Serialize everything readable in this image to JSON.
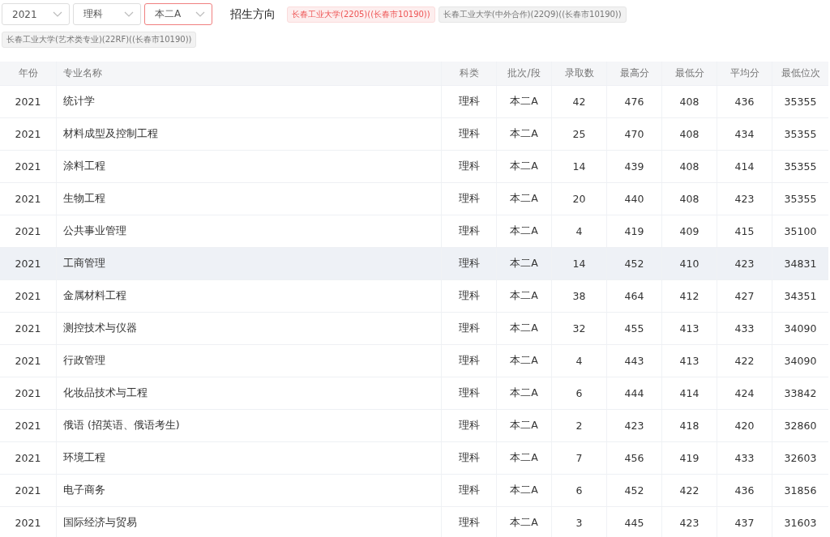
{
  "filters": [
    {
      "value": "2021",
      "active": false
    },
    {
      "value": "理科",
      "active": false
    },
    {
      "value": "本二A",
      "active": true
    }
  ],
  "direction_label": "招生方向",
  "direction_tags": [
    {
      "label": "长春工业大学(2205)((长春市10190))",
      "selected": true
    },
    {
      "label": "长春工业大学(中外合作)(22Q9)((长春市10190))",
      "selected": false
    },
    {
      "label": "长春工业大学(艺术类专业)(22RF)((长春市10190))",
      "selected": false
    }
  ],
  "table": {
    "columns": [
      "年份",
      "专业名称",
      "科类",
      "批次/段",
      "录取数",
      "最高分",
      "最低分",
      "平均分",
      "最低位次"
    ],
    "rows": [
      {
        "cells": [
          "2021",
          "统计学",
          "理科",
          "本二A",
          "42",
          "476",
          "408",
          "436",
          "35355"
        ],
        "hovered": false
      },
      {
        "cells": [
          "2021",
          "材料成型及控制工程",
          "理科",
          "本二A",
          "25",
          "470",
          "408",
          "434",
          "35355"
        ],
        "hovered": false
      },
      {
        "cells": [
          "2021",
          "涂料工程",
          "理科",
          "本二A",
          "14",
          "439",
          "408",
          "414",
          "35355"
        ],
        "hovered": false
      },
      {
        "cells": [
          "2021",
          "生物工程",
          "理科",
          "本二A",
          "20",
          "440",
          "408",
          "423",
          "35355"
        ],
        "hovered": false
      },
      {
        "cells": [
          "2021",
          "公共事业管理",
          "理科",
          "本二A",
          "4",
          "419",
          "409",
          "415",
          "35100"
        ],
        "hovered": false
      },
      {
        "cells": [
          "2021",
          "工商管理",
          "理科",
          "本二A",
          "14",
          "452",
          "410",
          "423",
          "34831"
        ],
        "hovered": true
      },
      {
        "cells": [
          "2021",
          "金属材料工程",
          "理科",
          "本二A",
          "38",
          "464",
          "412",
          "427",
          "34351"
        ],
        "hovered": false
      },
      {
        "cells": [
          "2021",
          "测控技术与仪器",
          "理科",
          "本二A",
          "32",
          "455",
          "413",
          "433",
          "34090"
        ],
        "hovered": false
      },
      {
        "cells": [
          "2021",
          "行政管理",
          "理科",
          "本二A",
          "4",
          "443",
          "413",
          "422",
          "34090"
        ],
        "hovered": false
      },
      {
        "cells": [
          "2021",
          "化妆品技术与工程",
          "理科",
          "本二A",
          "6",
          "444",
          "414",
          "424",
          "33842"
        ],
        "hovered": false
      },
      {
        "cells": [
          "2021",
          "俄语 (招英语、俄语考生)",
          "理科",
          "本二A",
          "2",
          "423",
          "418",
          "420",
          "32860"
        ],
        "hovered": false
      },
      {
        "cells": [
          "2021",
          "环境工程",
          "理科",
          "本二A",
          "7",
          "456",
          "419",
          "433",
          "32603"
        ],
        "hovered": false
      },
      {
        "cells": [
          "2021",
          "电子商务",
          "理科",
          "本二A",
          "6",
          "452",
          "422",
          "436",
          "31856"
        ],
        "hovered": false
      },
      {
        "cells": [
          "2021",
          "国际经济与贸易",
          "理科",
          "本二A",
          "3",
          "445",
          "423",
          "437",
          "31603"
        ],
        "hovered": false
      }
    ]
  }
}
